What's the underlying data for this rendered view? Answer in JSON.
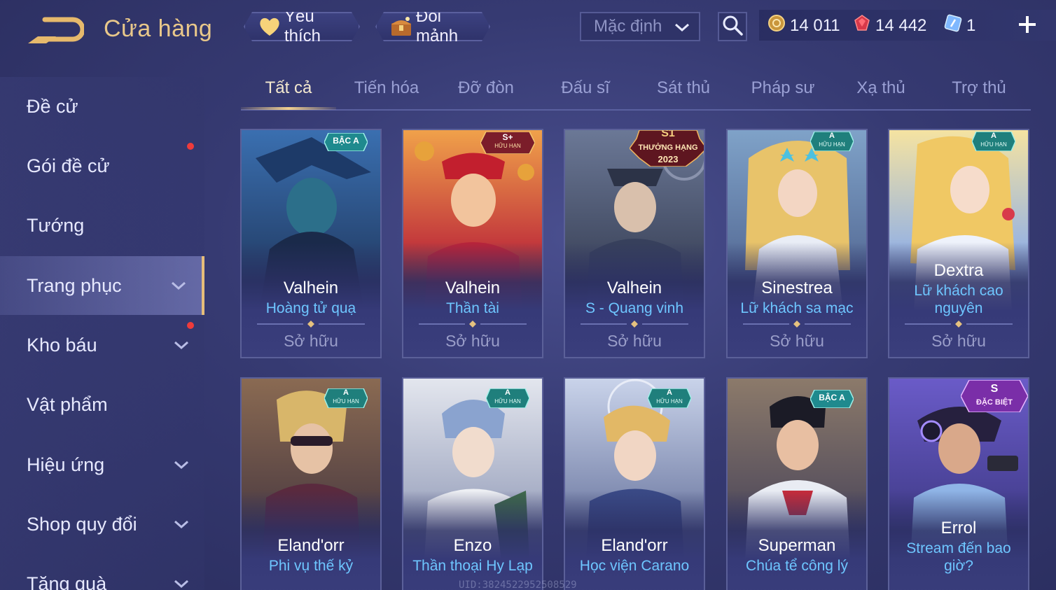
{
  "header": {
    "title": "Cửa hàng",
    "favorite_label": "Yêu thích",
    "exchange_label": "Đổi mảnh",
    "sort_value": "Mặc định",
    "currencies": [
      {
        "icon": "gold-coin-icon",
        "value": "14 011"
      },
      {
        "icon": "red-gem-icon",
        "value": "14 442"
      },
      {
        "icon": "ticket-icon",
        "value": "1"
      }
    ]
  },
  "sidebar": {
    "items": [
      {
        "label": "Đề cử"
      },
      {
        "label": "Gói đề cử"
      },
      {
        "label": "Tướng"
      },
      {
        "label": "Trang phục"
      },
      {
        "label": "Kho báu"
      },
      {
        "label": "Vật phẩm"
      },
      {
        "label": "Hiệu ứng"
      },
      {
        "label": "Shop quy đổi"
      },
      {
        "label": "Tặng quà"
      }
    ]
  },
  "tabs": [
    "Tất cả",
    "Tiến hóa",
    "Đỡ đòn",
    "Đấu sĩ",
    "Sát thủ",
    "Pháp sư",
    "Xạ thủ",
    "Trợ thủ"
  ],
  "cards": [
    {
      "hero": "Valhein",
      "skin": "Hoàng tử quạ",
      "status": "Sở hữu",
      "badge": "BẬC A"
    },
    {
      "hero": "Valhein",
      "skin": "Thần tài",
      "status": "Sở hữu",
      "badge": "S+",
      "badge_sub": "HỮU HẠN"
    },
    {
      "hero": "Valhein",
      "skin": "S - Quang vinh",
      "status": "Sở hữu",
      "badge": "S1",
      "badge_sub": "THƯỞNG HẠNG",
      "badge_year": "2023"
    },
    {
      "hero": "Sinestrea",
      "skin": "Lữ khách sa mạc",
      "status": "Sở hữu",
      "badge": "A",
      "badge_sub": "HỮU HẠN"
    },
    {
      "hero": "Dextra",
      "skin": "Lữ khách cao nguyên",
      "status": "Sở hữu",
      "badge": "A",
      "badge_sub": "HỮU HẠN"
    },
    {
      "hero": "Eland'orr",
      "skin": "Phi vụ thế kỷ",
      "badge": "A",
      "badge_sub": "HỮU HẠN"
    },
    {
      "hero": "Enzo",
      "skin": "Thần thoại Hy Lạp",
      "badge": "A",
      "badge_sub": "HỮU HẠN"
    },
    {
      "hero": "Eland'orr",
      "skin": "Học viện Carano",
      "badge": "A",
      "badge_sub": "HỮU HẠN"
    },
    {
      "hero": "Superman",
      "skin": "Chúa tể công lý",
      "badge": "BẬC A"
    },
    {
      "hero": "Errol",
      "skin": "Stream đến bao giờ?",
      "badge": "S",
      "badge_sub": "ĐẶC BIỆT"
    }
  ],
  "uid_text": "UID:382452295250852​9",
  "colors": {
    "accent_gold": "#e9c88a",
    "skin_name_blue": "#6ec6ff",
    "notification_red": "#ef3b3b"
  }
}
